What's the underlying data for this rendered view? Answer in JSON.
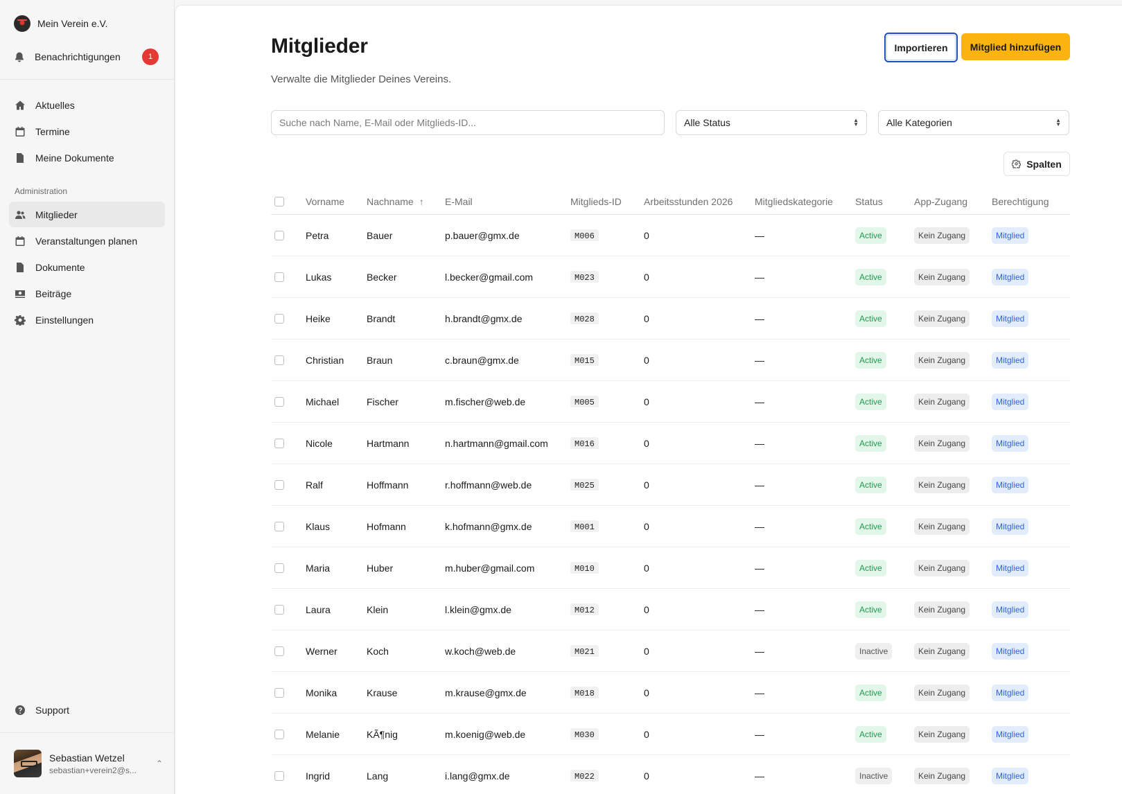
{
  "sidebar": {
    "org_name": "Mein Verein e.V.",
    "notifications_label": "Benachrichtigungen",
    "notifications_count": "1",
    "nav_main": [
      {
        "label": "Aktuelles",
        "icon": "home-icon"
      },
      {
        "label": "Termine",
        "icon": "calendar-icon"
      },
      {
        "label": "Meine Dokumente",
        "icon": "document-icon"
      }
    ],
    "admin_label": "Administration",
    "nav_admin": [
      {
        "label": "Mitglieder",
        "icon": "users-icon",
        "active": true
      },
      {
        "label": "Veranstaltungen planen",
        "icon": "calendar-icon"
      },
      {
        "label": "Dokumente",
        "icon": "document-icon"
      },
      {
        "label": "Beiträge",
        "icon": "money-icon"
      },
      {
        "label": "Einstellungen",
        "icon": "gear-icon"
      }
    ],
    "support_label": "Support",
    "user": {
      "name": "Sebastian Wetzel",
      "email": "sebastian+verein2@s..."
    }
  },
  "page": {
    "title": "Mitglieder",
    "subtitle": "Verwalte die Mitglieder Deines Vereins.",
    "import_label": "Importieren",
    "add_label": "Mitglied hinzufügen",
    "search_placeholder": "Suche nach Name, E-Mail oder Mitglieds-ID...",
    "status_filter": "Alle Status",
    "category_filter": "Alle Kategorien",
    "columns_label": "Spalten"
  },
  "table": {
    "headers": [
      "Vorname",
      "Nachname",
      "E-Mail",
      "Mitglieds-ID",
      "Arbeitsstunden 2026",
      "Mitgliedskategorie",
      "Status",
      "App-Zugang",
      "Berechtigung"
    ],
    "sort_indicator": "↑",
    "rows": [
      {
        "vorname": "Petra",
        "nachname": "Bauer",
        "email": "p.bauer@gmx.de",
        "id": "M006",
        "hours": "0",
        "kategorie": "—",
        "status": "Active",
        "app": "Kein Zugang",
        "berechtigung": "Mitglied"
      },
      {
        "vorname": "Lukas",
        "nachname": "Becker",
        "email": "l.becker@gmail.com",
        "id": "M023",
        "hours": "0",
        "kategorie": "—",
        "status": "Active",
        "app": "Kein Zugang",
        "berechtigung": "Mitglied"
      },
      {
        "vorname": "Heike",
        "nachname": "Brandt",
        "email": "h.brandt@gmx.de",
        "id": "M028",
        "hours": "0",
        "kategorie": "—",
        "status": "Active",
        "app": "Kein Zugang",
        "berechtigung": "Mitglied"
      },
      {
        "vorname": "Christian",
        "nachname": "Braun",
        "email": "c.braun@gmx.de",
        "id": "M015",
        "hours": "0",
        "kategorie": "—",
        "status": "Active",
        "app": "Kein Zugang",
        "berechtigung": "Mitglied"
      },
      {
        "vorname": "Michael",
        "nachname": "Fischer",
        "email": "m.fischer@web.de",
        "id": "M005",
        "hours": "0",
        "kategorie": "—",
        "status": "Active",
        "app": "Kein Zugang",
        "berechtigung": "Mitglied"
      },
      {
        "vorname": "Nicole",
        "nachname": "Hartmann",
        "email": "n.hartmann@gmail.com",
        "id": "M016",
        "hours": "0",
        "kategorie": "—",
        "status": "Active",
        "app": "Kein Zugang",
        "berechtigung": "Mitglied"
      },
      {
        "vorname": "Ralf",
        "nachname": "Hoffmann",
        "email": "r.hoffmann@web.de",
        "id": "M025",
        "hours": "0",
        "kategorie": "—",
        "status": "Active",
        "app": "Kein Zugang",
        "berechtigung": "Mitglied"
      },
      {
        "vorname": "Klaus",
        "nachname": "Hofmann",
        "email": "k.hofmann@gmx.de",
        "id": "M001",
        "hours": "0",
        "kategorie": "—",
        "status": "Active",
        "app": "Kein Zugang",
        "berechtigung": "Mitglied"
      },
      {
        "vorname": "Maria",
        "nachname": "Huber",
        "email": "m.huber@gmail.com",
        "id": "M010",
        "hours": "0",
        "kategorie": "—",
        "status": "Active",
        "app": "Kein Zugang",
        "berechtigung": "Mitglied"
      },
      {
        "vorname": "Laura",
        "nachname": "Klein",
        "email": "l.klein@gmx.de",
        "id": "M012",
        "hours": "0",
        "kategorie": "—",
        "status": "Active",
        "app": "Kein Zugang",
        "berechtigung": "Mitglied"
      },
      {
        "vorname": "Werner",
        "nachname": "Koch",
        "email": "w.koch@web.de",
        "id": "M021",
        "hours": "0",
        "kategorie": "—",
        "status": "Inactive",
        "app": "Kein Zugang",
        "berechtigung": "Mitglied"
      },
      {
        "vorname": "Monika",
        "nachname": "Krause",
        "email": "m.krause@gmx.de",
        "id": "M018",
        "hours": "0",
        "kategorie": "—",
        "status": "Active",
        "app": "Kein Zugang",
        "berechtigung": "Mitglied"
      },
      {
        "vorname": "Melanie",
        "nachname": "KÃ¶nig",
        "email": "m.koenig@web.de",
        "id": "M030",
        "hours": "0",
        "kategorie": "—",
        "status": "Active",
        "app": "Kein Zugang",
        "berechtigung": "Mitglied"
      },
      {
        "vorname": "Ingrid",
        "nachname": "Lang",
        "email": "i.lang@gmx.de",
        "id": "M022",
        "hours": "0",
        "kategorie": "—",
        "status": "Inactive",
        "app": "Kein Zugang",
        "berechtigung": "Mitglied"
      }
    ]
  },
  "colors": {
    "accent": "#fbb40e",
    "active_green": "#1f9a4d",
    "permission_blue": "#2f64d3",
    "badge_red": "#e53935"
  }
}
